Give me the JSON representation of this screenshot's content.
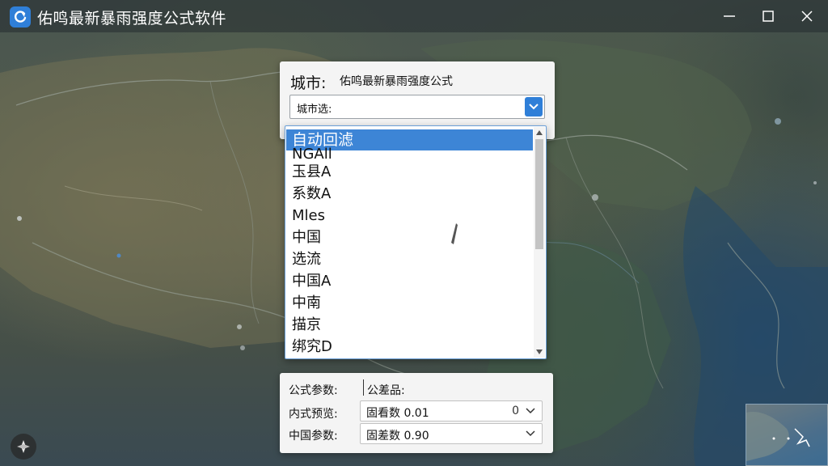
{
  "window": {
    "title": "佑鸣最新暴雨强度公式软件",
    "icon": "app-refresh-icon",
    "controls": [
      "minimize-icon",
      "maximize-icon",
      "close-icon"
    ]
  },
  "city_panel": {
    "label": "城市:",
    "formula_text": "佑鸣最新暴雨强度公式",
    "select": {
      "value": "城市选:",
      "arrow_icon": "chevron-down-icon"
    }
  },
  "dropdown": {
    "items": [
      {
        "label": "自动回滤",
        "selected": true
      },
      {
        "label": "NGAll",
        "selected": false
      },
      {
        "label": "玉县A",
        "selected": false
      },
      {
        "label": "系数A",
        "selected": false
      },
      {
        "label": "Mles",
        "selected": false
      },
      {
        "label": "中国",
        "selected": false
      },
      {
        "label": "选流",
        "selected": false
      },
      {
        "label": "中国A",
        "selected": false
      },
      {
        "label": "中南",
        "selected": false
      },
      {
        "label": "描京",
        "selected": false
      },
      {
        "label": "绑究D",
        "selected": false
      }
    ]
  },
  "params_panel": {
    "header_label": "公式参数:",
    "header_value": "公差品:",
    "rows": [
      {
        "label": "内式预览:",
        "value": "固看数 0.01",
        "suffix": "0"
      },
      {
        "label": "中国参数:",
        "value": "固差数 0.90",
        "suffix": ""
      }
    ]
  },
  "map": {
    "compass_icon": "location-compass-icon",
    "minimap_icon": "minimap-thumbnail"
  },
  "colors": {
    "accent": "#2f7fd8",
    "selection": "#3d85d6",
    "panel_bg": "#f4f4f4"
  }
}
